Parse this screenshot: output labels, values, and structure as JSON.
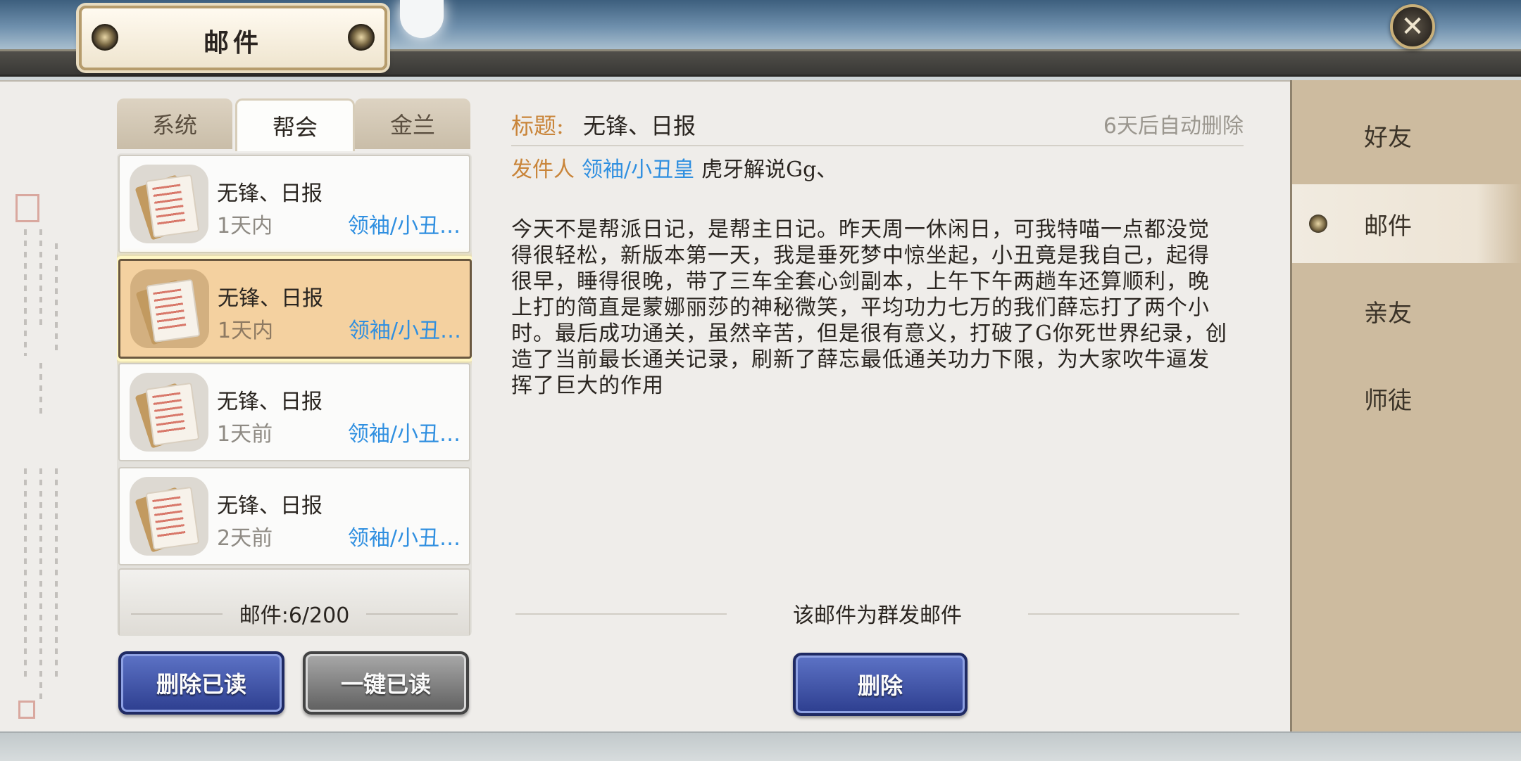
{
  "header": {
    "title": "邮件"
  },
  "tabs": [
    {
      "label": "系统"
    },
    {
      "label": "帮会"
    },
    {
      "label": "金兰"
    }
  ],
  "side_nav": [
    {
      "label": "好友"
    },
    {
      "label": "邮件"
    },
    {
      "label": "亲友"
    },
    {
      "label": "师徒"
    }
  ],
  "mail_list": [
    {
      "title": "无锋、日报",
      "time": "1天内",
      "sender": "领袖/小丑…"
    },
    {
      "title": "无锋、日报",
      "time": "1天内",
      "sender": "领袖/小丑…"
    },
    {
      "title": "无锋、日报",
      "time": "1天前",
      "sender": "领袖/小丑…"
    },
    {
      "title": "无锋、日报",
      "time": "2天前",
      "sender": "领袖/小丑…"
    }
  ],
  "mail_count": "邮件:6/200",
  "buttons": {
    "delete_read": "删除已读",
    "read_all": "一键已读",
    "delete": "删除"
  },
  "detail": {
    "subject_label": "标题:",
    "subject": "无锋、日报",
    "auto_delete": "6天后自动删除",
    "sender_label": "发件人",
    "sender_guild": "领袖/小丑皇",
    "sender_name": "虎牙解说Gg、",
    "body": "今天不是帮派日记，是帮主日记。昨天周一休闲日，可我特喵一点都没觉得很轻松，新版本第一天，我是垂死梦中惊坐起，小丑竟是我自己，起得很早，睡得很晚，带了三车全套心剑副本，上午下午两趟车还算顺利，晚上打的简直是蒙娜丽莎的神秘微笑，平均功力七万的我们薛忘打了两个小时。最后成功通关，虽然辛苦，但是很有意义，打破了G你死世界纪录，创造了当前最长通关记录，刷新了薛忘最低通关功力下限，为大家吹牛逼发挥了巨大的作用",
    "group_note": "该邮件为群发邮件"
  }
}
